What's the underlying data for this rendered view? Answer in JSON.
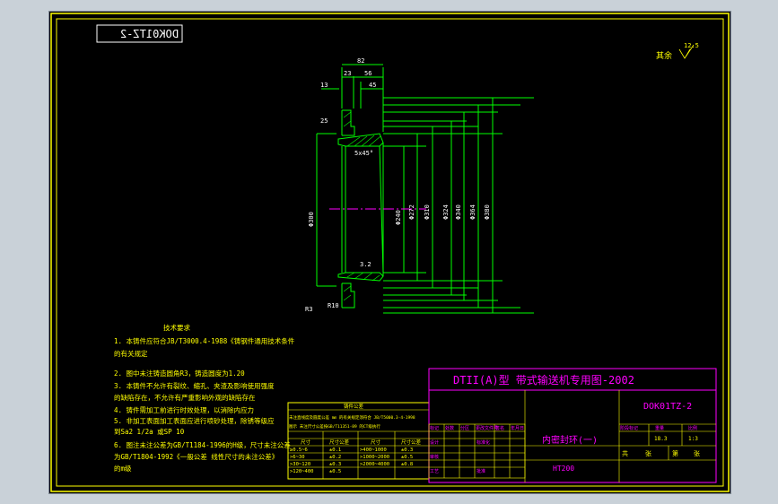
{
  "colors": {
    "canvas_bg": "#c9d1d8",
    "drawing_bg": "#000000",
    "frame": "#ffff00",
    "geometry": "#00ff00",
    "centerline": "#ff00ff",
    "text": "#ffff00",
    "title_text": "#ff00ff",
    "label_white": "#ffffff"
  },
  "drawing": {
    "mirrored_code": "DOK01TZ-2",
    "roughness_note": "其余",
    "roughness_value": "12.5",
    "dims": {
      "top_82": "82",
      "top_23": "23",
      "top_56": "56",
      "top_45": "45",
      "left_13": "13",
      "angle_25": "25",
      "chamfer": "5x45°",
      "rough_32": "3.2",
      "r3": "R3",
      "r10": "R10",
      "d300": "Φ300",
      "d240": "Φ240",
      "d272": "Φ272",
      "d310": "Φ310",
      "d324": "Φ324",
      "d340": "Φ340",
      "d364": "Φ364",
      "d380": "Φ380"
    }
  },
  "tech_req": {
    "heading": "技术要求",
    "lines": [
      "1. 本铸件应符合JB/T3000.4-1988《铸钢件通用技术条件",
      "   的有关规定",
      "2. 图中未注铸造圆角R3，铸造圆度为1.20",
      "3. 本铸件不允许有裂纹、缩孔、夹渣及影响使用强度",
      "   的缺陷存在，不允许有严重影响外观的缺陷存在",
      "4. 铸件需加工前进行时效处理，以消除内应力",
      "5. 非加工表面加工表面应进行喷砂处理，除锈等级应",
      "   到Sa2 1/2a 或SP 10",
      "6. 图注未注公差为GB/T1184-1996的H级，尺寸未注公差",
      "   为GB/T1804-1992《一般公差   线性尺寸的未注公差》",
      "   的m级"
    ]
  },
  "tolerance_table": {
    "title": "铸件公差",
    "note1": "未注直线度及圆度公差 mm 的有关规定须符合 JB/T5000.3-4-1998",
    "note2": "图示 未注尺寸公差按GB/T11351-89 的CT级执行",
    "header": [
      "尺寸",
      "尺寸公差",
      "尺寸",
      "尺寸公差"
    ],
    "rows": [
      [
        "≥0.5~6",
        "±0.1",
        ">400~1000",
        "±0.3"
      ],
      [
        ">6~30",
        "±0.2",
        ">1000~2000",
        "±0.5"
      ],
      [
        ">30~120",
        "±0.3",
        ">2000~4000",
        "±0.8"
      ],
      [
        ">120~400",
        "±0.5",
        "",
        ""
      ]
    ]
  },
  "title_block": {
    "title": "DTII(A)型  带式输送机专用图-2002",
    "drawing_no": "DOK01TZ-2",
    "part_name": "内密封环(一)",
    "material": "HT200",
    "stage_label": "阶段标记",
    "weight_label": "重量",
    "scale_label": "比例",
    "weight_value": "18.3",
    "scale_value": "1:3",
    "sheet_total": "共",
    "sheet_label": "张",
    "sheet_no": "第",
    "sheet_label2": "张",
    "rev_headers": [
      "标记",
      "处数",
      "分区",
      "更改文件号",
      "签名",
      "年月日"
    ],
    "roles": [
      "设计",
      "审核",
      "工艺",
      "标准化",
      "批准"
    ],
    "roles_right": [
      "标准化",
      "批准"
    ]
  }
}
